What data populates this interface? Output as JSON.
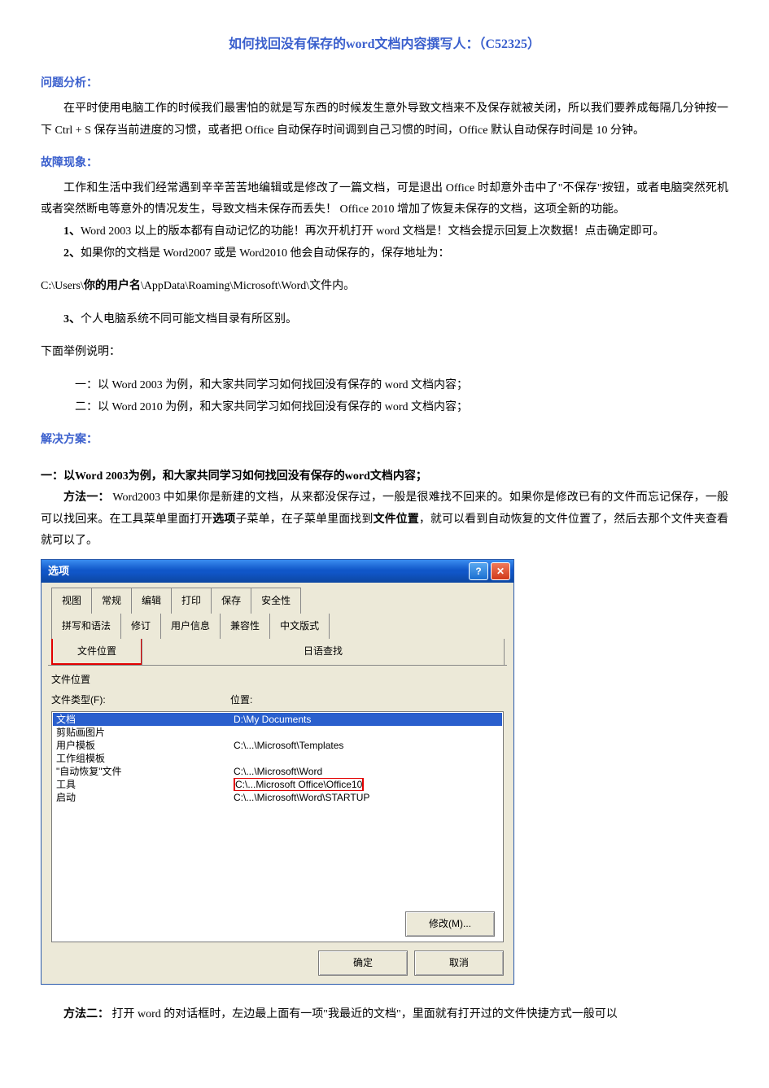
{
  "title": "如何找回没有保存的word文档内容撰写人：（C52325）",
  "sections": {
    "analysis": {
      "heading": "问题分析：",
      "text": "在平时使用电脑工作的时候我们最害怕的就是写东西的时候发生意外导致文档来不及保存就被关闭，所以我们要养成每隔几分钟按一下 Ctrl + S 保存当前进度的习惯，或者把 Office 自动保存时间调到自己习惯的时间，Office 默认自动保存时间是 10 分钟。"
    },
    "symptom": {
      "heading": "故障现象：",
      "intro": "工作和生活中我们经常遇到辛辛苦苦地编辑或是修改了一篇文档，可是退出 Office 时却意外击中了\"不保存\"按钮，或者电脑突然死机或者突然断电等意外的情况发生，导致文档未保存而丢失！ Office 2010 增加了恢复未保存的文档，这项全新的功能。",
      "p1_lead": "1、",
      "p1": "Word 2003 以上的版本都有自动记忆的功能！再次开机打开 word 文档是！文档会提示回复上次数据！点击确定即可。",
      "p2_lead": "2、",
      "p2a": "如果你的文档是 Word2007 或是 Word2010 他会自动保存的，保存地址为：",
      "p2b_pre": "C:\\Users\\",
      "p2b_bold": "你的用户名",
      "p2b_post": "\\AppData\\Roaming\\Microsoft\\Word\\文件内。",
      "p3_lead": "3、",
      "p3": "个人电脑系统不同可能文档目录有所区别。",
      "examples_intro": "下面举例说明：",
      "ex1": "一：以 Word 2003 为例，和大家共同学习如何找回没有保存的 word 文档内容；",
      "ex2": "二：以 Word 2010 为例，和大家共同学习如何找回没有保存的 word 文档内容；"
    },
    "solution": {
      "heading": "解决方案：",
      "sub1_heading": "一：以Word 2003为例，和大家共同学习如何找回没有保存的word文档内容；",
      "m1_lead": "方法一：",
      "m1_a": " Word2003 中如果你是新建的文档，从来都没保存过，一般是很难找不回来的。如果你是修改已有的文件而忘记保存，一般可以找回来。在工具菜单里面打开",
      "m1_opt": "选项",
      "m1_b": "子菜单，在子菜单里面找到",
      "m1_fileloc": "文件位置",
      "m1_c": "，就可以看到自动恢复的文件位置了，然后去那个文件夹查看就可以了。",
      "m2_lead": "方法二：",
      "m2_text": " 打开 word 的对话框时，左边最上面有一项\"我最近的文档\"，里面就有打开过的文件快捷方式一般可以"
    }
  },
  "dialog": {
    "title": "选项",
    "tabs_row1": [
      "视图",
      "常规",
      "编辑",
      "打印",
      "保存",
      "安全性"
    ],
    "tabs_row2": [
      "拼写和语法",
      "修订",
      "用户信息",
      "兼容性",
      "中文版式"
    ],
    "tabs_row3": {
      "file_location": "文件位置",
      "jp_search": "日语查找"
    },
    "panel_label": "文件位置",
    "col_type": "文件类型(F):",
    "col_loc": "位置:",
    "rows": [
      {
        "type": "文档",
        "loc": "D:\\My Documents",
        "selected": true
      },
      {
        "type": "剪贴画图片",
        "loc": ""
      },
      {
        "type": "用户模板",
        "loc": "C:\\...\\Microsoft\\Templates"
      },
      {
        "type": "工作组模板",
        "loc": ""
      },
      {
        "type": "\"自动恢复\"文件",
        "loc": "C:\\...\\Microsoft\\Word"
      },
      {
        "type": "工具",
        "loc": "C:\\...Microsoft Office\\Office10",
        "hl": true
      },
      {
        "type": "启动",
        "loc": "C:\\...\\Microsoft\\Word\\STARTUP"
      }
    ],
    "btn_modify": "修改(M)...",
    "btn_ok": "确定",
    "btn_cancel": "取消"
  }
}
